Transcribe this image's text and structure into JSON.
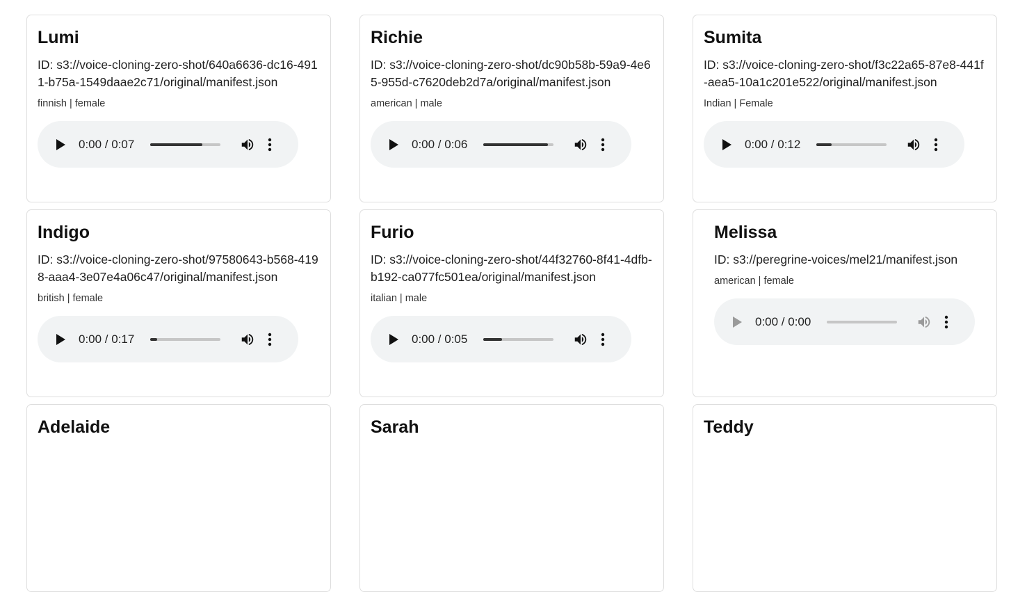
{
  "colors": {
    "player_bg": "#f1f3f4",
    "card_border": "#dedede",
    "seek_track": "#c6c6c6",
    "seek_fill": "#333333"
  },
  "voices": [
    {
      "name": "Lumi",
      "id_text": "ID: s3://voice-cloning-zero-shot/640a6636-dc16-4911-b75a-1549daae2c71/original/manifest.json",
      "tags": "finnish | female",
      "time": "0:00 / 0:07",
      "progress": 0.74,
      "disabled": false
    },
    {
      "name": "Richie",
      "id_text": "ID: s3://voice-cloning-zero-shot/dc90b58b-59a9-4e65-955d-c7620deb2d7a/original/manifest.json",
      "tags": "american | male",
      "time": "0:00 / 0:06",
      "progress": 0.92,
      "disabled": false
    },
    {
      "name": "Sumita",
      "id_text": "ID: s3://voice-cloning-zero-shot/f3c22a65-87e8-441f-aea5-10a1c201e522/original/manifest.json",
      "tags": "Indian | Female",
      "time": "0:00 / 0:12",
      "progress": 0.22,
      "disabled": false
    },
    {
      "name": "Indigo",
      "id_text": "ID: s3://voice-cloning-zero-shot/97580643-b568-4198-aaa4-3e07e4a06c47/original/manifest.json",
      "tags": "british | female",
      "time": "0:00 / 0:17",
      "progress": 0.1,
      "disabled": false
    },
    {
      "name": "Furio",
      "id_text": "ID: s3://voice-cloning-zero-shot/44f32760-8f41-4dfb-b192-ca077fc501ea/original/manifest.json",
      "tags": "italian | male",
      "time": "0:00 / 0:05",
      "progress": 0.27,
      "disabled": false
    },
    {
      "name": "Melissa",
      "id_text": "ID: s3://peregrine-voices/mel21/manifest.json",
      "tags": "american | female",
      "time": "0:00 / 0:00",
      "progress": 0,
      "disabled": true
    },
    {
      "name": "Adelaide",
      "id_text": "",
      "tags": "",
      "time": "",
      "progress": 0,
      "disabled": false
    },
    {
      "name": "Sarah",
      "id_text": "",
      "tags": "",
      "time": "",
      "progress": 0,
      "disabled": false
    },
    {
      "name": "Teddy",
      "id_text": "",
      "tags": "",
      "time": "",
      "progress": 0,
      "disabled": false
    }
  ]
}
